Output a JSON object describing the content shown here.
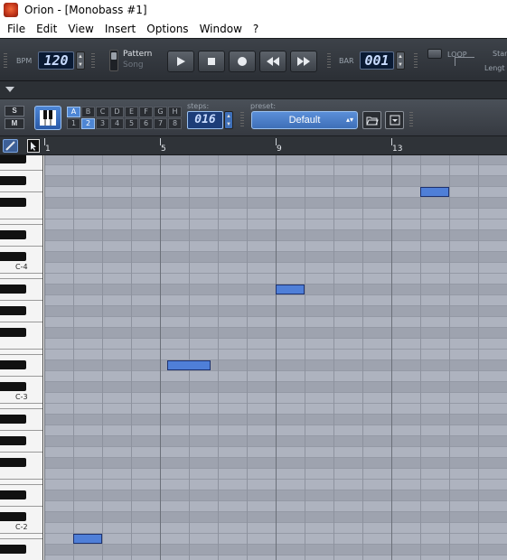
{
  "window": {
    "title": "Orion - [Monobass #1]"
  },
  "menu": [
    "File",
    "Edit",
    "View",
    "Insert",
    "Options",
    "Window",
    "?"
  ],
  "transport": {
    "bpm_label": "BPM",
    "bpm_value": "120",
    "pattern_label": "Pattern",
    "song_label": "Song",
    "bar_label": "BAR",
    "bar_value": "001",
    "loop_label": "LOOP",
    "start_label": "Star",
    "length_label": "Lengt"
  },
  "pattern_toolbar": {
    "solo_label": "S",
    "mute_label": "M",
    "bank_letters": [
      "A",
      "B",
      "C",
      "D",
      "E",
      "F",
      "G",
      "H"
    ],
    "bank_numbers": [
      "1",
      "2",
      "3",
      "4",
      "5",
      "6",
      "7",
      "8"
    ],
    "active_letter": "A",
    "active_number": "2",
    "steps_label": "steps:",
    "steps_value": "016",
    "preset_label": "preset:",
    "preset_value": "Default"
  },
  "ruler": {
    "marks": [
      "1",
      "5",
      "9",
      "13"
    ]
  },
  "piano": {
    "octave_labels": [
      "C-4",
      "C-3",
      "C-2"
    ]
  },
  "notes": [
    {
      "start_step": 14,
      "length_steps": 1,
      "row": 3
    },
    {
      "start_step": 9,
      "length_steps": 1,
      "row": 12
    },
    {
      "start_step": 5.25,
      "length_steps": 1.5,
      "row": 19
    },
    {
      "start_step": 2,
      "length_steps": 1,
      "row": 35
    }
  ],
  "colors": {
    "accent": "#4f7fd8",
    "lcd_text": "#c9dcff",
    "toolbar": "#3d4249"
  },
  "icons": [
    "app-icon",
    "play-icon",
    "stop-icon",
    "record-icon",
    "rewind-icon",
    "fast-forward-icon",
    "piano-icon",
    "folder-open-icon",
    "save-preset-icon",
    "pencil-icon",
    "select-icon",
    "collapse-arrow-icon"
  ]
}
